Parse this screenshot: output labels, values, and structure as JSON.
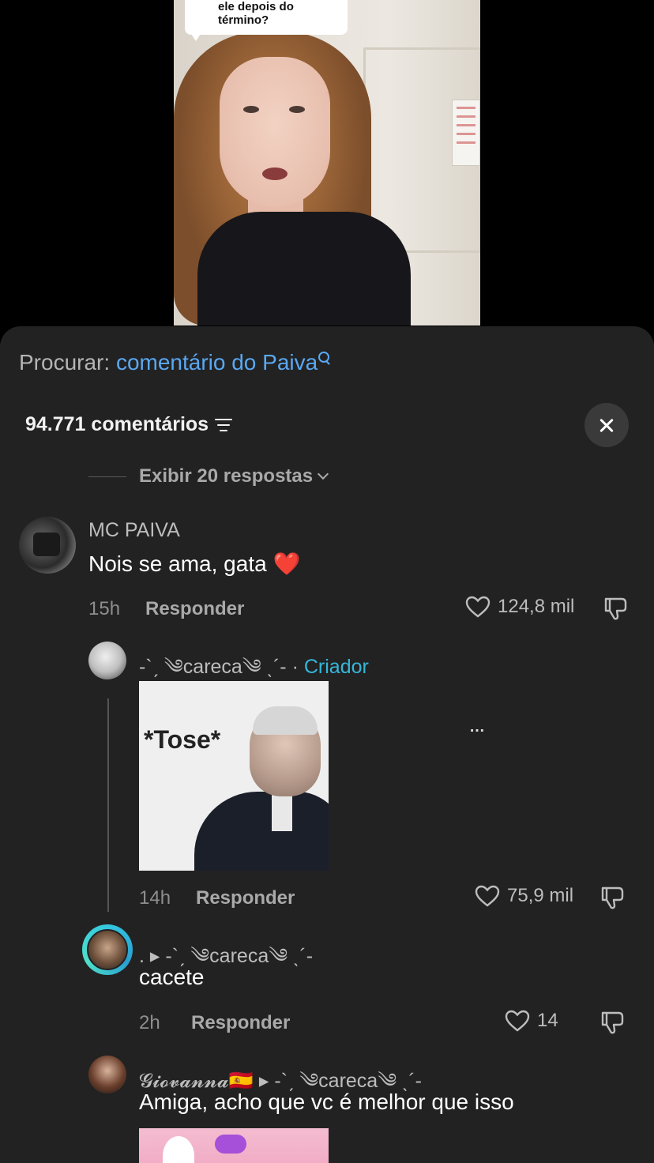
{
  "video": {
    "caption_line1": "ele depois do",
    "caption_line2": "término?"
  },
  "search": {
    "label": "Procurar:",
    "query": "comentário do Paiva"
  },
  "comments_header": {
    "count_label": "94.771 comentários"
  },
  "view_replies": "Exibir 20 respostas",
  "comments": [
    {
      "username": "MC PAIVA",
      "text": "Nois se ama, gata",
      "emoji": "❤️",
      "time": "15h",
      "reply_label": "Responder",
      "likes": "124,8 mil"
    },
    {
      "username": "-`ˏ ༄careca༄ ˎ´- ·",
      "badge": "Criador",
      "gif_text": "*Tose*",
      "ellipsis": "…",
      "time": "14h",
      "reply_label": "Responder",
      "likes": "75,9 mil"
    },
    {
      "username": ". ▸ -`ˏ ༄careca༄ ˎ´-",
      "text": "cacete",
      "time": "2h",
      "reply_label": "Responder",
      "likes": "14"
    },
    {
      "username": "𝓖𝓲𝓸𝓿𝓪𝓷𝓷𝓪🇪🇸 ▸ -`ˏ ༄careca༄ ˎ´-",
      "text": "Amiga, acho que vc é melhor que isso"
    }
  ],
  "colors": {
    "sheet_bg": "#222223",
    "accent_blue": "#5aa8f2",
    "creator_teal": "#35b6d9",
    "heart_red": "#ff2d3c"
  }
}
